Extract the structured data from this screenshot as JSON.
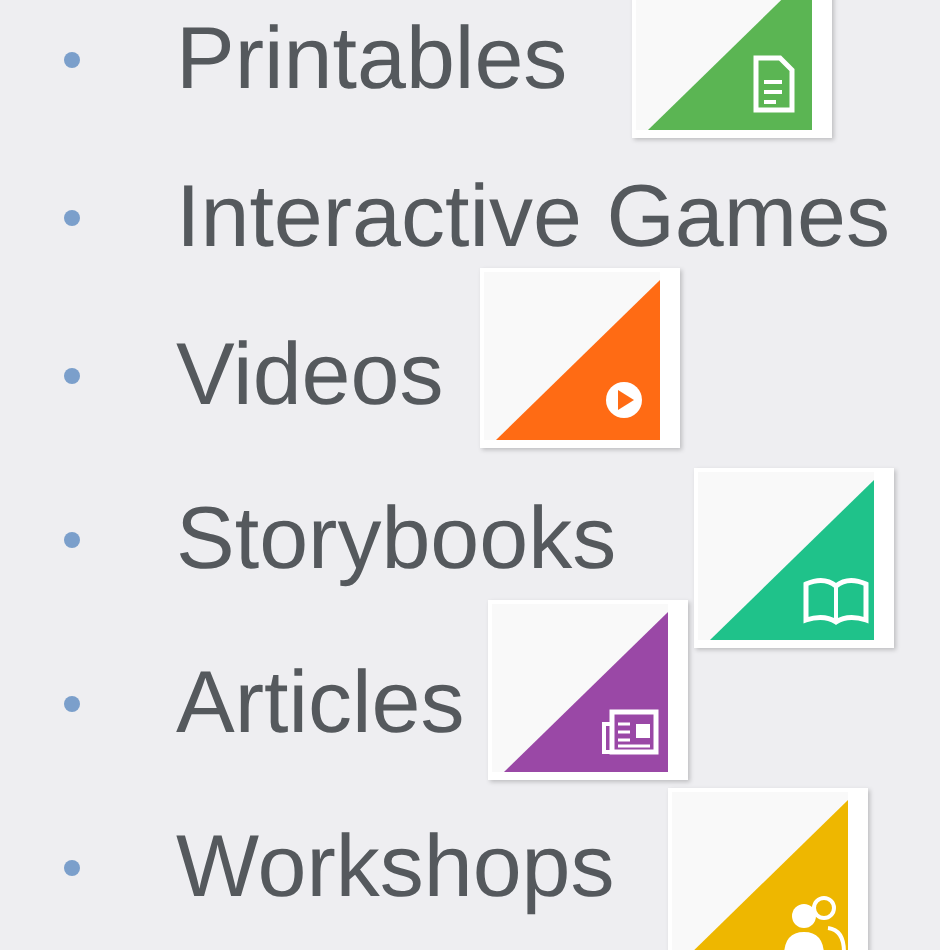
{
  "items": [
    {
      "label": "Printables",
      "kind": "document",
      "color": "#5bb553"
    },
    {
      "label": "Interactive Games",
      "kind": "plain"
    },
    {
      "label": "Videos",
      "kind": "play",
      "color": "#ff6b14"
    },
    {
      "label": "Storybooks",
      "kind": "book",
      "color": "#1fc28a"
    },
    {
      "label": "Articles",
      "kind": "newspaper",
      "color": "#9a48a6"
    },
    {
      "label": "Workshops",
      "kind": "people",
      "color": "#eeb700"
    }
  ]
}
